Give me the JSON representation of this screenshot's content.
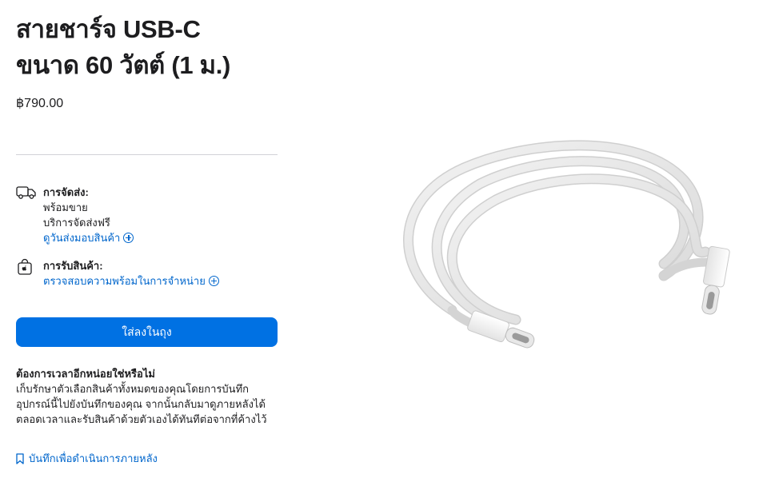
{
  "product": {
    "title_line1": "สายชาร์จ USB-C",
    "title_line2": "ขนาด 60 วัตต์ (1 ม.)",
    "price": "฿790.00"
  },
  "delivery": {
    "heading": "การจัดส่ง:",
    "line1": "พร้อมขาย",
    "line2": "บริการจัดส่งฟรี",
    "link": "ดูวันส่งมอบสินค้า",
    "icon": "truck-icon"
  },
  "pickup": {
    "heading": "การรับสินค้า:",
    "link": "ตรวจสอบความพร้อมในการจำหน่าย",
    "icon": "store-bag-icon"
  },
  "cta": {
    "label": "ใส่ลงในถุง"
  },
  "save": {
    "heading": "ต้องการเวลาอีกหน่อยใช่หรือไม่",
    "description": "เก็บรักษาตัวเลือกสินค้าทั้งหมดของคุณโดยการบันทึกอุปกรณ์นี้ไปยังบันทึกของคุณ จากนั้นกลับมาดูภายหลังได้ตลอดเวลาและรับสินค้าด้วยตัวเองได้ทันทีต่อจากที่ค้างไว้",
    "link": "บันทึกเพื่อดำเนินการภายหลัง",
    "icon": "bookmark-icon"
  },
  "colors": {
    "accent": "#0071e3",
    "link": "#0066cc",
    "divider": "#d2d2d7"
  }
}
